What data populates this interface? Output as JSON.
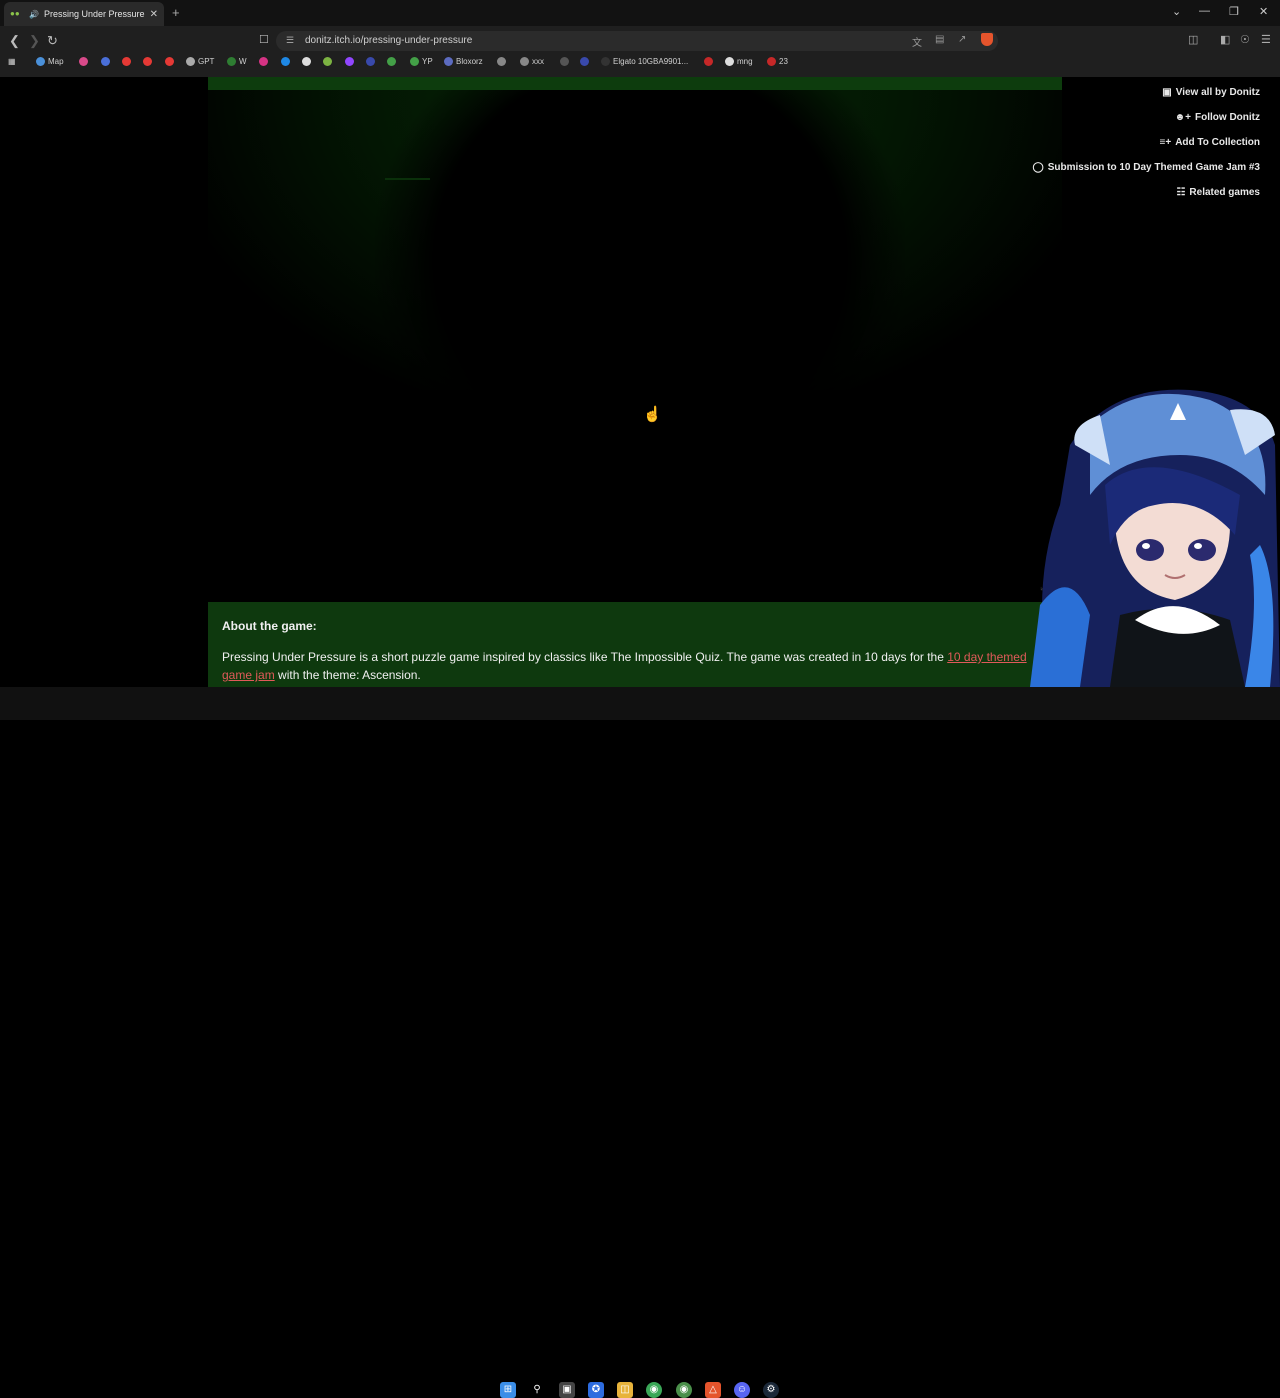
{
  "browser": {
    "tab_title": "Pressing Under Pressure by D",
    "url": "donitz.itch.io/pressing-under-pressure",
    "bookmarks": [
      {
        "label": "Map",
        "color": "#4a90d9"
      },
      {
        "label": "",
        "color": "#d94a8a"
      },
      {
        "label": "",
        "color": "#4a6fd9"
      },
      {
        "label": "",
        "color": "#e53935"
      },
      {
        "label": "",
        "color": "#e53935"
      },
      {
        "label": "",
        "color": "#e53935"
      },
      {
        "label": "GPT",
        "color": "#aaaaaa"
      },
      {
        "label": "W",
        "color": "#2e7d32"
      },
      {
        "label": "",
        "color": "#d63384"
      },
      {
        "label": "",
        "color": "#1e88e5"
      },
      {
        "label": "",
        "color": "#dddddd"
      },
      {
        "label": "",
        "color": "#7cb342"
      },
      {
        "label": "",
        "color": "#9146ff"
      },
      {
        "label": "",
        "color": "#3949ab"
      },
      {
        "label": "",
        "color": "#43a047"
      },
      {
        "label": "YP",
        "color": "#43a047"
      },
      {
        "label": "Bloxorz",
        "color": "#5c6bc0"
      },
      {
        "label": "",
        "color": "#888888"
      },
      {
        "label": "xxx",
        "color": "#888888"
      },
      {
        "label": "",
        "color": "#555555"
      },
      {
        "label": "",
        "color": "#3949ab"
      },
      {
        "label": "Elgato 10GBA9901...",
        "color": "#333333"
      },
      {
        "label": "",
        "color": "#c62828"
      },
      {
        "label": "mng",
        "color": "#dddddd"
      },
      {
        "label": "23",
        "color": "#c62828"
      }
    ]
  },
  "side_links": [
    {
      "label": "View all by Donitz",
      "icon": "gamepad-icon"
    },
    {
      "label": "Follow Donitz",
      "icon": "add-user-icon"
    },
    {
      "label": "Add To Collection",
      "icon": "add-list-icon"
    },
    {
      "label": "Submission to 10 Day Themed Game Jam #3",
      "icon": "award-icon"
    },
    {
      "label": "Related games",
      "icon": "map-icon"
    }
  ],
  "about": {
    "heading": "About the game:",
    "text_before": "Pressing Under Pressure is a short puzzle game inspired by classics like The Impossible Quiz. The game was created in 10 days for the ",
    "link_text": "10 day themed game jam",
    "text_after": " with the theme: Ascension."
  }
}
